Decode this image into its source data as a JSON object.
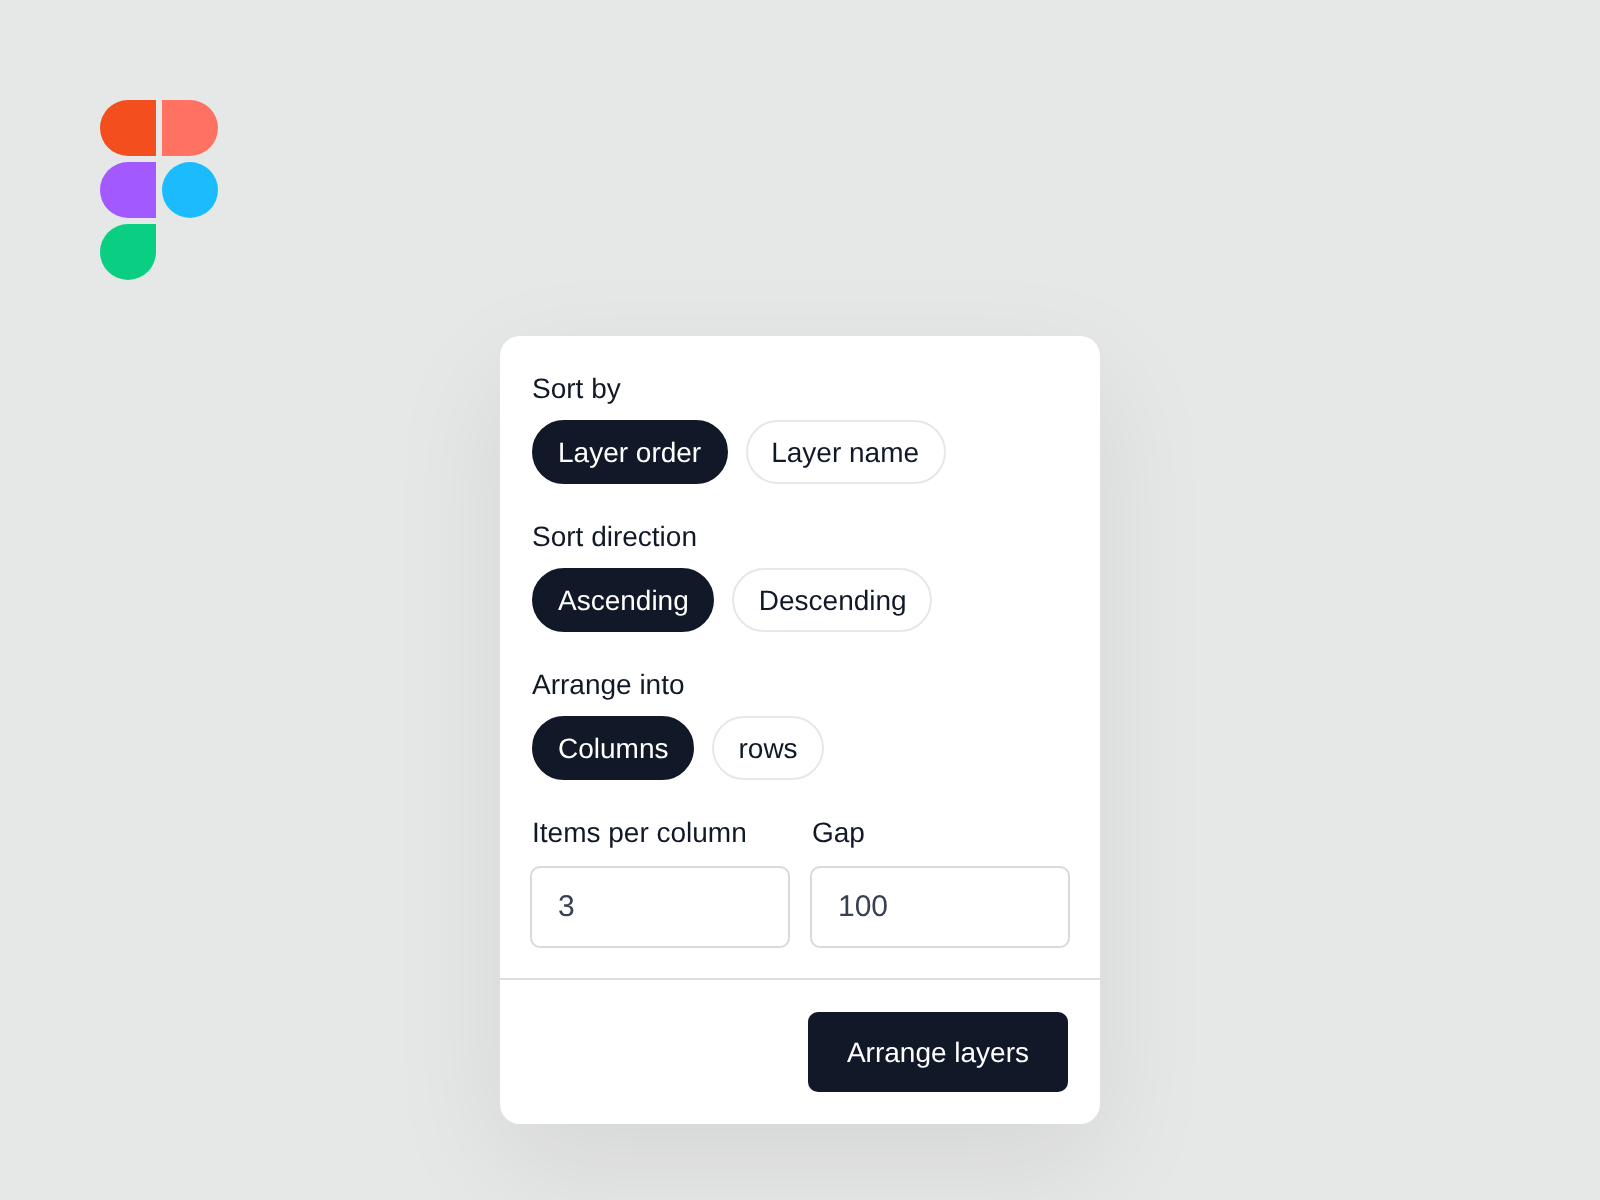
{
  "sections": [
    {
      "label": "Sort by",
      "options": [
        {
          "label": "Layer order",
          "selected": true
        },
        {
          "label": "Layer name",
          "selected": false
        }
      ]
    },
    {
      "label": "Sort direction",
      "options": [
        {
          "label": "Ascending",
          "selected": true
        },
        {
          "label": "Descending",
          "selected": false
        }
      ]
    },
    {
      "label": "Arrange into",
      "options": [
        {
          "label": "Columns",
          "selected": true
        },
        {
          "label": "rows",
          "selected": false
        }
      ]
    }
  ],
  "fields": [
    {
      "label": "Items per column",
      "value": "3"
    },
    {
      "label": "Gap",
      "value": "100"
    }
  ],
  "primary_button": {
    "label": "Arrange layers"
  }
}
